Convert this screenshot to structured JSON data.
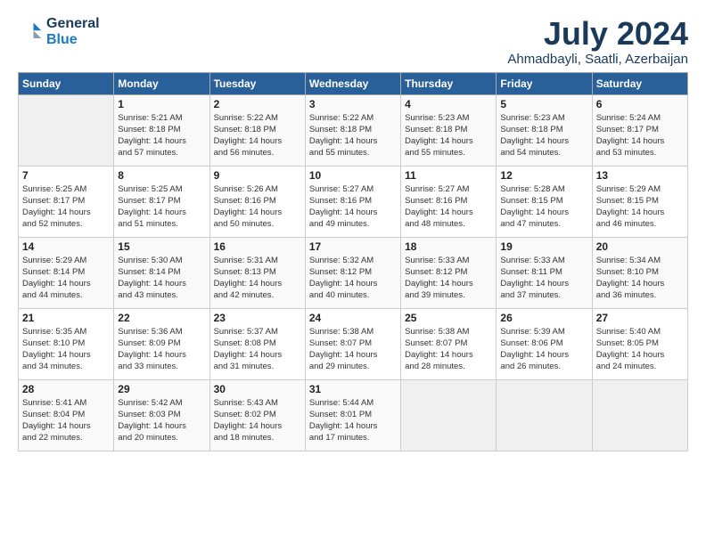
{
  "logo": {
    "line1": "General",
    "line2": "Blue"
  },
  "title": "July 2024",
  "subtitle": "Ahmadbayli, Saatli, Azerbaijan",
  "days_of_week": [
    "Sunday",
    "Monday",
    "Tuesday",
    "Wednesday",
    "Thursday",
    "Friday",
    "Saturday"
  ],
  "weeks": [
    [
      {
        "day": "",
        "info": ""
      },
      {
        "day": "1",
        "info": "Sunrise: 5:21 AM\nSunset: 8:18 PM\nDaylight: 14 hours\nand 57 minutes."
      },
      {
        "day": "2",
        "info": "Sunrise: 5:22 AM\nSunset: 8:18 PM\nDaylight: 14 hours\nand 56 minutes."
      },
      {
        "day": "3",
        "info": "Sunrise: 5:22 AM\nSunset: 8:18 PM\nDaylight: 14 hours\nand 55 minutes."
      },
      {
        "day": "4",
        "info": "Sunrise: 5:23 AM\nSunset: 8:18 PM\nDaylight: 14 hours\nand 55 minutes."
      },
      {
        "day": "5",
        "info": "Sunrise: 5:23 AM\nSunset: 8:18 PM\nDaylight: 14 hours\nand 54 minutes."
      },
      {
        "day": "6",
        "info": "Sunrise: 5:24 AM\nSunset: 8:17 PM\nDaylight: 14 hours\nand 53 minutes."
      }
    ],
    [
      {
        "day": "7",
        "info": "Sunrise: 5:25 AM\nSunset: 8:17 PM\nDaylight: 14 hours\nand 52 minutes."
      },
      {
        "day": "8",
        "info": "Sunrise: 5:25 AM\nSunset: 8:17 PM\nDaylight: 14 hours\nand 51 minutes."
      },
      {
        "day": "9",
        "info": "Sunrise: 5:26 AM\nSunset: 8:16 PM\nDaylight: 14 hours\nand 50 minutes."
      },
      {
        "day": "10",
        "info": "Sunrise: 5:27 AM\nSunset: 8:16 PM\nDaylight: 14 hours\nand 49 minutes."
      },
      {
        "day": "11",
        "info": "Sunrise: 5:27 AM\nSunset: 8:16 PM\nDaylight: 14 hours\nand 48 minutes."
      },
      {
        "day": "12",
        "info": "Sunrise: 5:28 AM\nSunset: 8:15 PM\nDaylight: 14 hours\nand 47 minutes."
      },
      {
        "day": "13",
        "info": "Sunrise: 5:29 AM\nSunset: 8:15 PM\nDaylight: 14 hours\nand 46 minutes."
      }
    ],
    [
      {
        "day": "14",
        "info": "Sunrise: 5:29 AM\nSunset: 8:14 PM\nDaylight: 14 hours\nand 44 minutes."
      },
      {
        "day": "15",
        "info": "Sunrise: 5:30 AM\nSunset: 8:14 PM\nDaylight: 14 hours\nand 43 minutes."
      },
      {
        "day": "16",
        "info": "Sunrise: 5:31 AM\nSunset: 8:13 PM\nDaylight: 14 hours\nand 42 minutes."
      },
      {
        "day": "17",
        "info": "Sunrise: 5:32 AM\nSunset: 8:12 PM\nDaylight: 14 hours\nand 40 minutes."
      },
      {
        "day": "18",
        "info": "Sunrise: 5:33 AM\nSunset: 8:12 PM\nDaylight: 14 hours\nand 39 minutes."
      },
      {
        "day": "19",
        "info": "Sunrise: 5:33 AM\nSunset: 8:11 PM\nDaylight: 14 hours\nand 37 minutes."
      },
      {
        "day": "20",
        "info": "Sunrise: 5:34 AM\nSunset: 8:10 PM\nDaylight: 14 hours\nand 36 minutes."
      }
    ],
    [
      {
        "day": "21",
        "info": "Sunrise: 5:35 AM\nSunset: 8:10 PM\nDaylight: 14 hours\nand 34 minutes."
      },
      {
        "day": "22",
        "info": "Sunrise: 5:36 AM\nSunset: 8:09 PM\nDaylight: 14 hours\nand 33 minutes."
      },
      {
        "day": "23",
        "info": "Sunrise: 5:37 AM\nSunset: 8:08 PM\nDaylight: 14 hours\nand 31 minutes."
      },
      {
        "day": "24",
        "info": "Sunrise: 5:38 AM\nSunset: 8:07 PM\nDaylight: 14 hours\nand 29 minutes."
      },
      {
        "day": "25",
        "info": "Sunrise: 5:38 AM\nSunset: 8:07 PM\nDaylight: 14 hours\nand 28 minutes."
      },
      {
        "day": "26",
        "info": "Sunrise: 5:39 AM\nSunset: 8:06 PM\nDaylight: 14 hours\nand 26 minutes."
      },
      {
        "day": "27",
        "info": "Sunrise: 5:40 AM\nSunset: 8:05 PM\nDaylight: 14 hours\nand 24 minutes."
      }
    ],
    [
      {
        "day": "28",
        "info": "Sunrise: 5:41 AM\nSunset: 8:04 PM\nDaylight: 14 hours\nand 22 minutes."
      },
      {
        "day": "29",
        "info": "Sunrise: 5:42 AM\nSunset: 8:03 PM\nDaylight: 14 hours\nand 20 minutes."
      },
      {
        "day": "30",
        "info": "Sunrise: 5:43 AM\nSunset: 8:02 PM\nDaylight: 14 hours\nand 18 minutes."
      },
      {
        "day": "31",
        "info": "Sunrise: 5:44 AM\nSunset: 8:01 PM\nDaylight: 14 hours\nand 17 minutes."
      },
      {
        "day": "",
        "info": ""
      },
      {
        "day": "",
        "info": ""
      },
      {
        "day": "",
        "info": ""
      }
    ]
  ]
}
